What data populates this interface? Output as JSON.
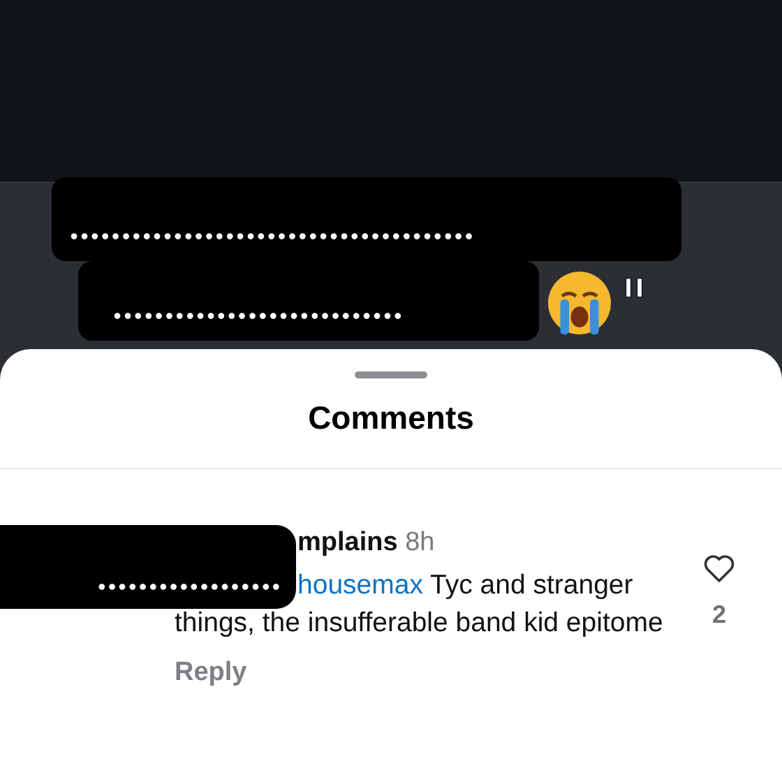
{
  "video": {
    "captions": [
      {
        "text": "●●●●●●●●●●●●●●●●●●●●●●●●●●●●●●●●●●●●●●●"
      },
      {
        "text": "●●●●●●●●●●●●●●●●●●●●●●●●●●●●"
      }
    ]
  },
  "sheet": {
    "title": "Comments"
  },
  "comments": [
    {
      "redaction": "●●●●●●●●●●●●●●●●●●",
      "username": "mplains",
      "time": "8h",
      "mention": "housemax",
      "text": " Tyc and stranger things, the insufferable band kid epitome",
      "reply": "Reply",
      "likes": "2",
      "liked": false
    }
  ]
}
